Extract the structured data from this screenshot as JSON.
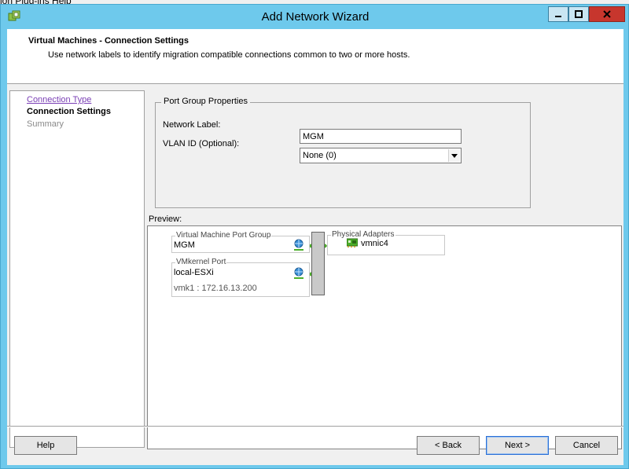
{
  "background_menu": {
    "text": "ion   Plug-ins   Help"
  },
  "window": {
    "title": "Add Network Wizard",
    "controls": {
      "minimize": "minimize",
      "maximize": "maximize",
      "close": "close"
    }
  },
  "header": {
    "title": "Virtual Machines - Connection Settings",
    "subtitle": "Use network labels to identify migration compatible connections common to two or more hosts."
  },
  "steps": {
    "items": [
      {
        "label": "Connection Type",
        "state": "done"
      },
      {
        "label": "Connection Settings",
        "state": "current"
      },
      {
        "label": "Summary",
        "state": "future"
      }
    ]
  },
  "port_group": {
    "title": "Port Group Properties",
    "network_label_caption": "Network Label:",
    "network_label_value": "MGM",
    "vlan_caption": "VLAN ID (Optional):",
    "vlan_value": "None (0)"
  },
  "preview": {
    "label": "Preview:",
    "vm_port_group": {
      "title": "Virtual Machine Port Group",
      "name": "MGM"
    },
    "vmkernel": {
      "title": "VMkernel Port",
      "name": "local-ESXi",
      "detail": "vmk1 : 172.16.13.200"
    },
    "physical": {
      "title": "Physical Adapters",
      "nic": "vmnic4"
    }
  },
  "footer": {
    "help": "Help",
    "back": "< Back",
    "next": "Next >",
    "cancel": "Cancel"
  },
  "colors": {
    "titlebar": "#6ec9ec",
    "close_button": "#c7362d",
    "link_visited": "#7a3fb5",
    "port_connector": "#4caf2a"
  }
}
